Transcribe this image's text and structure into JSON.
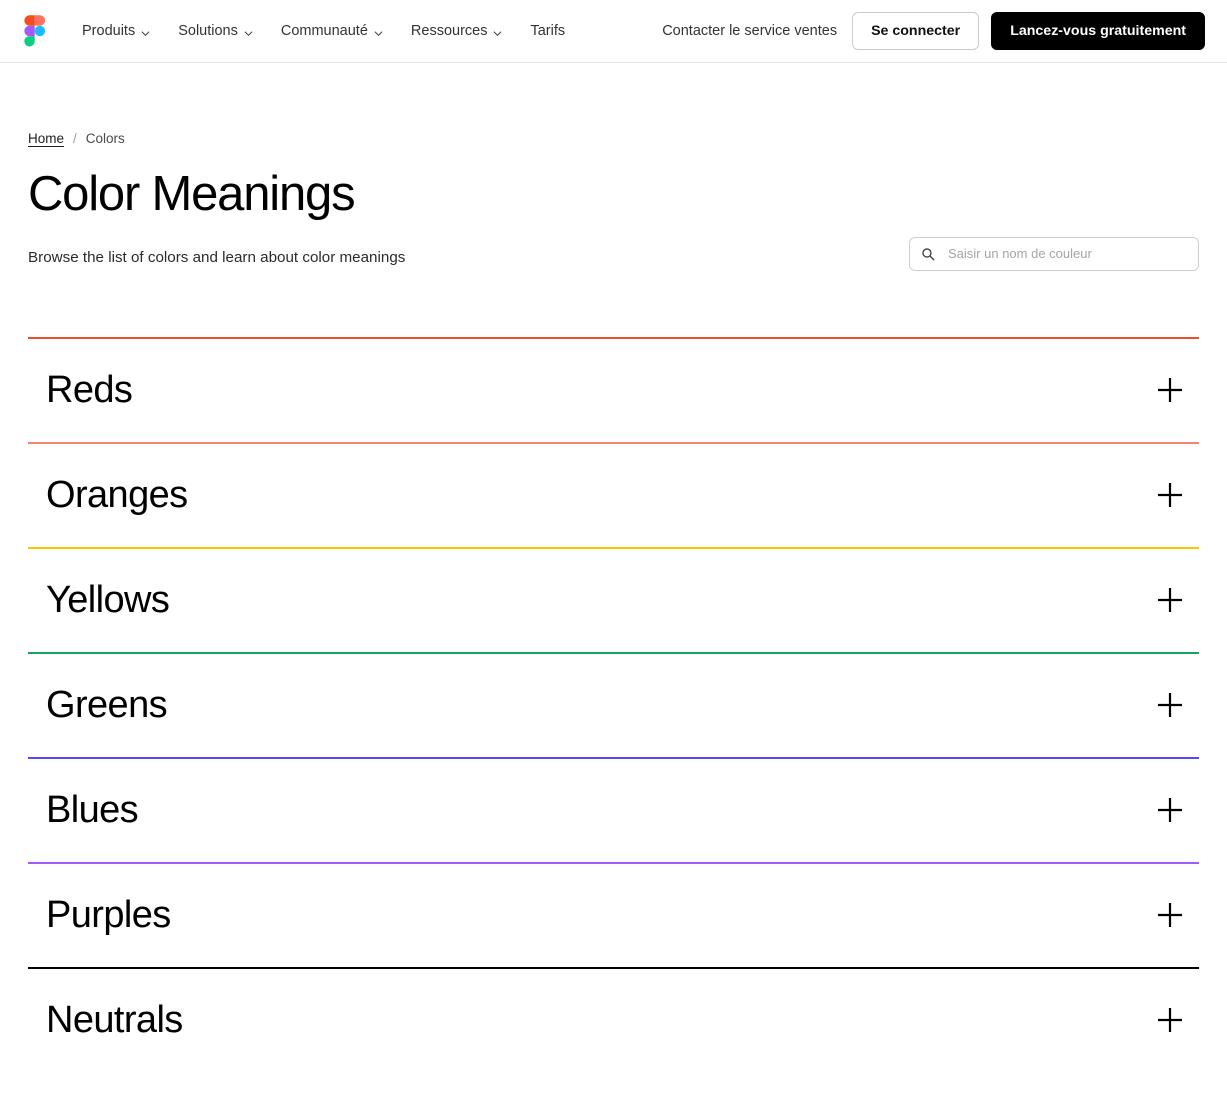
{
  "navbar": {
    "logo_name": "figma-logo",
    "links": [
      {
        "label": "Produits",
        "has_dropdown": true
      },
      {
        "label": "Solutions",
        "has_dropdown": true
      },
      {
        "label": "Communauté",
        "has_dropdown": true
      },
      {
        "label": "Ressources",
        "has_dropdown": true
      },
      {
        "label": "Tarifs",
        "has_dropdown": false
      }
    ],
    "contact_sales": "Contacter le service ventes",
    "login_label": "Se connecter",
    "signup_label": "Lancez-vous gratuitement"
  },
  "breadcrumb": {
    "home": "Home",
    "separator": "/",
    "current": "Colors"
  },
  "header": {
    "title": "Color Meanings",
    "subtitle": "Browse the list of colors and learn about color meanings"
  },
  "search": {
    "icon": "search-icon",
    "placeholder": "Saisir un nom de couleur",
    "value": ""
  },
  "accordion": {
    "expand_icon": "plus-icon",
    "top_divider_color": "#E8502B",
    "items": [
      {
        "label": "Reds",
        "divider_color": "#F58474"
      },
      {
        "label": "Oranges",
        "divider_color": "#FDC700"
      },
      {
        "label": "Yellows",
        "divider_color": "#12A55C"
      },
      {
        "label": "Greens",
        "divider_color": "#5546FF"
      },
      {
        "label": "Blues",
        "divider_color": "#A259FF"
      },
      {
        "label": "Purples",
        "divider_color": "#000000"
      },
      {
        "label": "Neutrals",
        "divider_color": null
      }
    ]
  },
  "colors": {
    "brand_black": "#000000",
    "figma_red": "#F24E1E",
    "figma_orange": "#FF7262",
    "figma_purple": "#A259FF",
    "figma_blue": "#1ABCFE",
    "figma_green": "#0ACF83"
  }
}
